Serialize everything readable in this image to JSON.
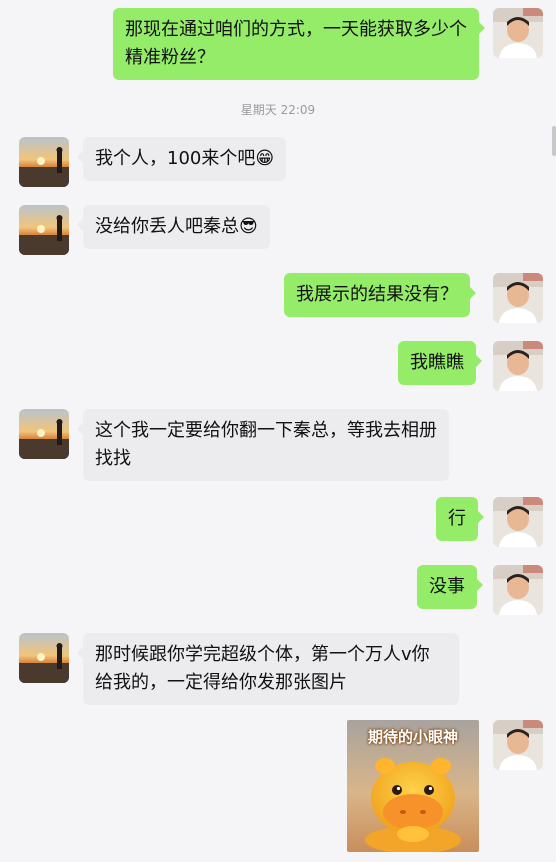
{
  "messages": [
    {
      "side": "out",
      "text": "那现在通过咱们的方式，一天能获取多少个精准粉丝？"
    },
    {
      "timestamp": "星期天 22:09"
    },
    {
      "side": "in",
      "text": "我个人，100来个吧",
      "emoji": "😁"
    },
    {
      "side": "in",
      "text": "没给你丢人吧秦总",
      "emoji": "😎"
    },
    {
      "side": "out",
      "text": "我展示的结果没有？"
    },
    {
      "side": "out",
      "text": "我瞧瞧"
    },
    {
      "side": "in",
      "text": "这个我一定要给你翻一下秦总，等我去相册找找"
    },
    {
      "side": "out",
      "text": "行"
    },
    {
      "side": "out",
      "text": "没事"
    },
    {
      "side": "in",
      "text": "那时候跟你学完超级个体，第一个万人v你给我的，一定得给你发那张图片"
    },
    {
      "side": "out",
      "sticker_caption": "期待的小眼神"
    }
  ],
  "colors": {
    "outgoing_bubble": "#95ec69",
    "incoming_bubble": "#ececee",
    "background": "#f5f5f7"
  }
}
